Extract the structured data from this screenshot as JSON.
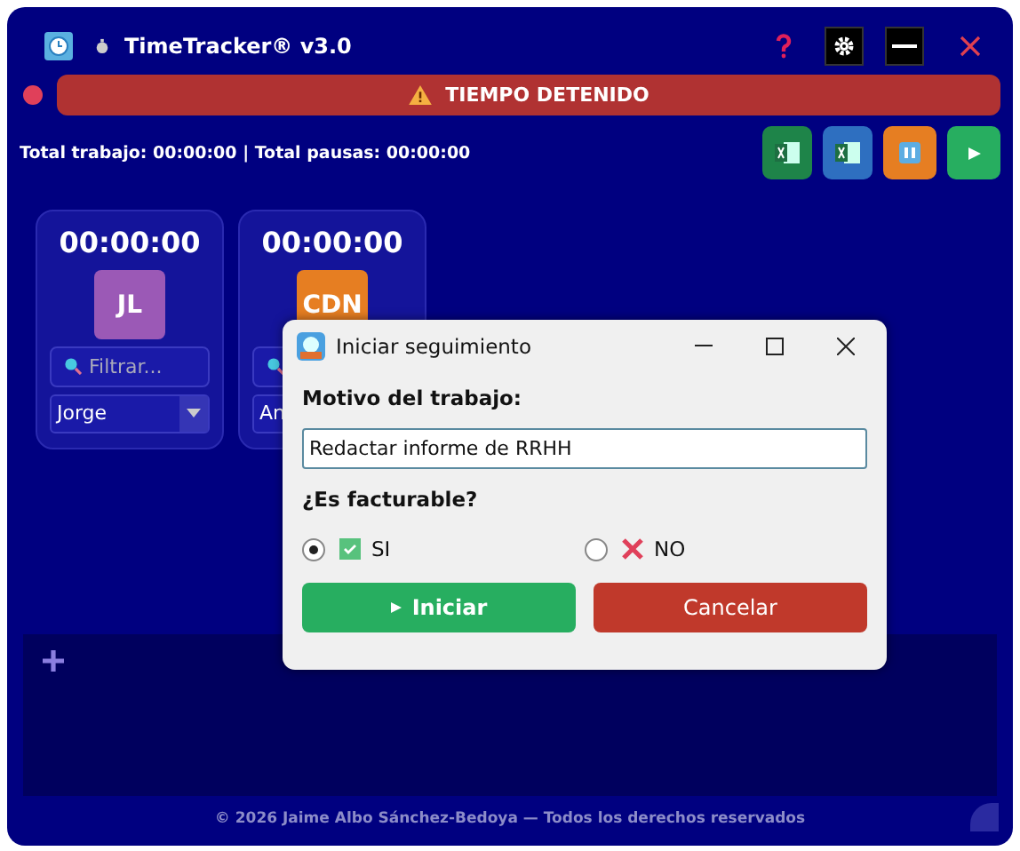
{
  "window": {
    "title": "TimeTracker® v3.0"
  },
  "status": {
    "recording": false,
    "message": "TIEMPO DETENIDO"
  },
  "totals": "Total trabajo: 00:00:00 | Total pausas: 00:00:00",
  "users": [
    {
      "time": "00:00:00",
      "initials": "JL",
      "color": "#9b59b6",
      "filter_placeholder": "Filtrar...",
      "selection": "Jorge"
    },
    {
      "time": "00:00:00",
      "initials": "CDN",
      "color": "#e67e22",
      "selection": "An"
    }
  ],
  "dialog": {
    "title": "Iniciar seguimiento",
    "reason_label": "Motivo del trabajo:",
    "reason_value": "Redactar informe de RRHH",
    "billable_label": "¿Es facturable?",
    "options": [
      {
        "label": "SI",
        "kind": "yes",
        "selected": true
      },
      {
        "label": "NO",
        "kind": "no",
        "selected": false
      }
    ],
    "start_button": "Iniciar",
    "cancel_button": "Cancelar"
  },
  "footer": "© 2026 Jaime Albo Sánchez-Bedoya — Todos los derechos reservados"
}
